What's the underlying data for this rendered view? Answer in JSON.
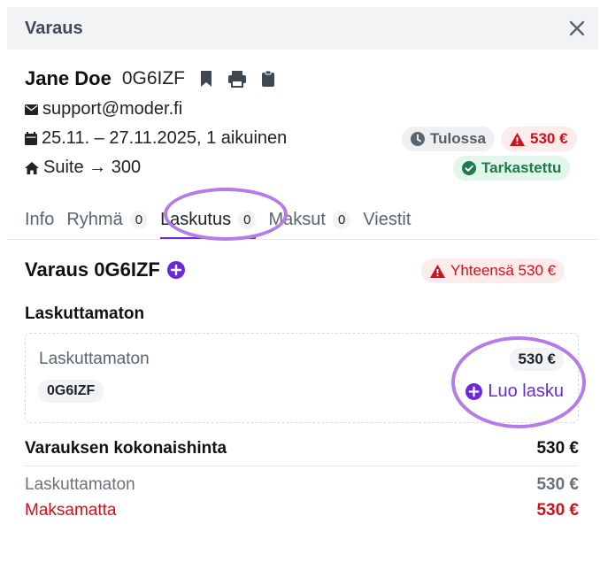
{
  "header": {
    "title": "Varaus"
  },
  "guest": {
    "name": "Jane Doe",
    "code": "0G6IZF"
  },
  "contact": {
    "email": "support@moder.fi"
  },
  "stay": {
    "dates": "25.11. – 27.11.2025, 1 aikuinen"
  },
  "room": {
    "text": "Suite → 300"
  },
  "badges": {
    "status": "Tulossa",
    "balance": "530 €",
    "check": "Tarkastettu"
  },
  "tabs": [
    {
      "label": "Info"
    },
    {
      "label": "Ryhmä",
      "count": "0"
    },
    {
      "label": "Laskutus",
      "count": "0",
      "active": true
    },
    {
      "label": "Maksut",
      "count": "0"
    },
    {
      "label": "Viestit"
    }
  ],
  "billing": {
    "title": "Varaus 0G6IZF",
    "total_badge": "Yhteensä 530 €",
    "subheading": "Laskuttamaton",
    "card": {
      "label": "Laskuttamaton",
      "amount": "530 €",
      "code": "0G6IZF",
      "action": "Luo lasku"
    },
    "summary": {
      "total_label": "Varauksen kokonaishinta",
      "total_value": "530 €",
      "uninvoiced_label": "Laskuttamaton",
      "uninvoiced_value": "530 €",
      "unpaid_label": "Maksamatta",
      "unpaid_value": "530 €"
    }
  },
  "colors": {
    "accent": "#6d28d9",
    "danger": "#d0111b",
    "success": "#1d7a4a",
    "annotation": "#b57be6"
  },
  "icons": [
    "close-icon",
    "bookmark-icon",
    "print-icon",
    "clipboard-icon",
    "mail-icon",
    "calendar-icon",
    "home-icon",
    "clock-icon",
    "warning-icon",
    "check-circle-icon",
    "plus-circle-icon"
  ]
}
